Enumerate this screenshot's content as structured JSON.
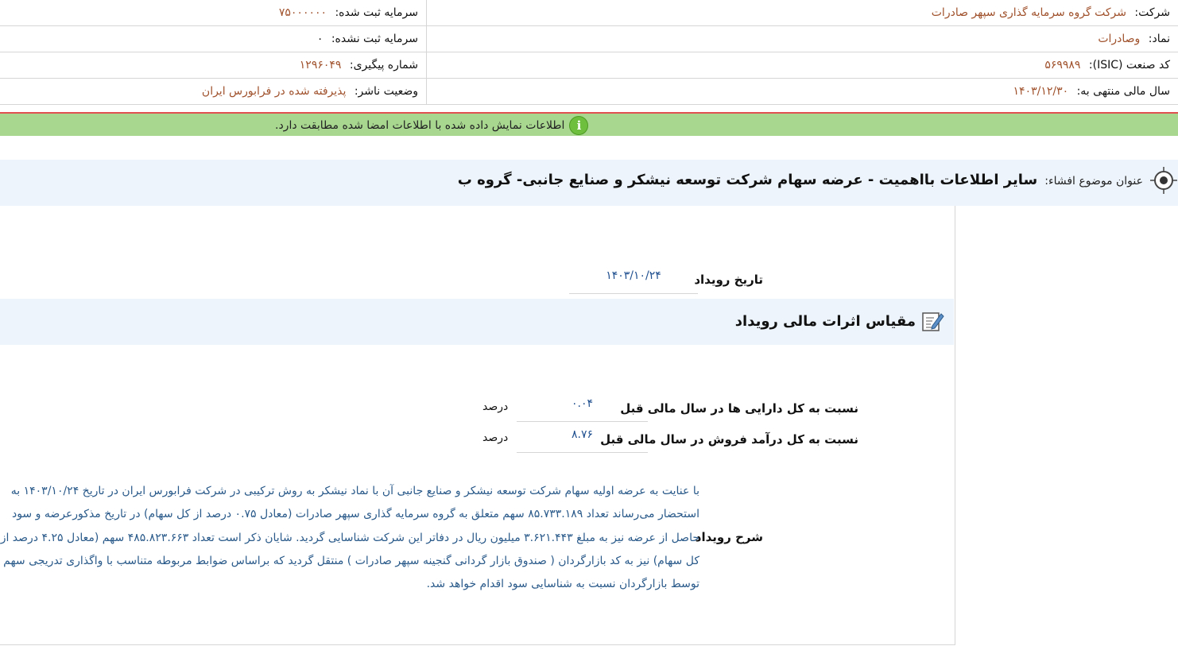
{
  "header": {
    "company_label": "شرکت:",
    "company_value": "شرکت گروه سرمایه گذاری سپهر صادرات",
    "capital_registered_label": "سرمایه ثبت شده:",
    "capital_registered_value": "۷۵۰۰۰۰۰۰",
    "symbol_label": "نماد:",
    "symbol_value": "وصادرات",
    "capital_unregistered_label": "سرمایه ثبت نشده:",
    "capital_unregistered_value": "۰",
    "isic_label": "کد صنعت (ISIC):",
    "isic_value": "۵۶۹۹۸۹",
    "tracking_label": "شماره پیگیری:",
    "tracking_value": "۱۲۹۶۰۴۹",
    "fiscal_label": "سال مالی منتهی به:",
    "fiscal_value": "۱۴۰۳/۱۲/۳۰",
    "publisher_status_label": "وضعیت ناشر:",
    "publisher_status_value": "پذیرفته شده در فرابورس ایران"
  },
  "verification": {
    "text": "اطلاعات نمایش داده شده با اطلاعات امضا شده مطابقت دارد.",
    "icon_char": "i",
    "icon_name": "info-icon"
  },
  "subject": {
    "label": "عنوان موضوع افشاء:",
    "title": "سایر اطلاعات بااهمیت - عرضه سهام شرکت توسعه نیشکر و صنایع جانبی- گروه ب"
  },
  "event": {
    "date_label": "تاریخ رویداد",
    "date_value": "۱۴۰۳/۱۰/۲۴"
  },
  "financial_section": {
    "title": "مقیاس اثرات مالی رویداد",
    "metrics": [
      {
        "label": "نسبت به کل دارایی ها در سال مالی قبل",
        "value": "۰.۰۴",
        "unit": "درصد"
      },
      {
        "label": "نسبت به کل درآمد فروش در سال مالی قبل",
        "value": "۸.۷۶",
        "unit": "درصد"
      }
    ]
  },
  "description": {
    "label": "شرح رویداد",
    "text": "با عنایت به عرضه اولیه سهام شرکت توسعه نیشکر و صنایع جانبی آن با نماد نیشکر به روش ترکیبی در شرکت فرابورس ایران در تاریخ ۱۴۰۳/۱۰/۲۴ به استحضار می‌رساند تعداد ۸۵.۷۳۳.۱۸۹ سهم متعلق به گروه سرمایه گذاری سپهر صادرات (معادل ۰.۷۵ درصد از کل سهام) در تاریخ مذکورعرضه و سود حاصل از عرضه نیز به مبلغ ۳.۶۲۱.۴۴۳ میلیون ریال در دفاتر این شرکت شناسایی گردید. شایان ذکر است تعداد ۴۸۵.۸۲۳.۶۶۳ سهم (معادل ۴.۲۵ درصد از کل سهام) نیز به کد بازارگردان ( صندوق بازار گردانی گنجینه سپهر صادرات ) منتقل گردید که براساس ضوابط مربوطه متناسب با واگذاری تدریجی سهم توسط بازارگردان نسبت به شناسایی سود اقدام خواهد شد."
  },
  "colors": {
    "value_text": "#a0522d",
    "link_blue": "#2a5a8a",
    "verify_green": "#a8d890",
    "verify_border": "#e05050",
    "section_bg": "#edf4fb"
  }
}
